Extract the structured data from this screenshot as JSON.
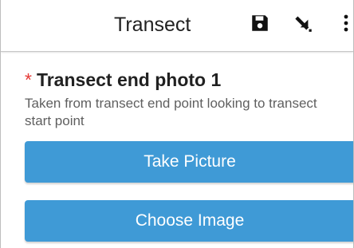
{
  "appbar": {
    "title": "Transect",
    "actions": [
      {
        "name": "save",
        "icon": "floppy-disk-save-icon"
      },
      {
        "name": "collapse",
        "icon": "arrow-down-right-icon"
      },
      {
        "name": "more",
        "icon": "vertical-ellipsis-icon"
      }
    ]
  },
  "question": {
    "required_mark": "*",
    "title": "Transect end photo 1",
    "hint": "Taken from transect end point looking to transect start point"
  },
  "buttons": {
    "take_picture": "Take Picture",
    "choose_image": "Choose Image"
  },
  "colors": {
    "button_blue": "#3f9ad6",
    "required_red": "#e53935",
    "text_dark": "#212121",
    "hint_gray": "#5f5f5f"
  }
}
